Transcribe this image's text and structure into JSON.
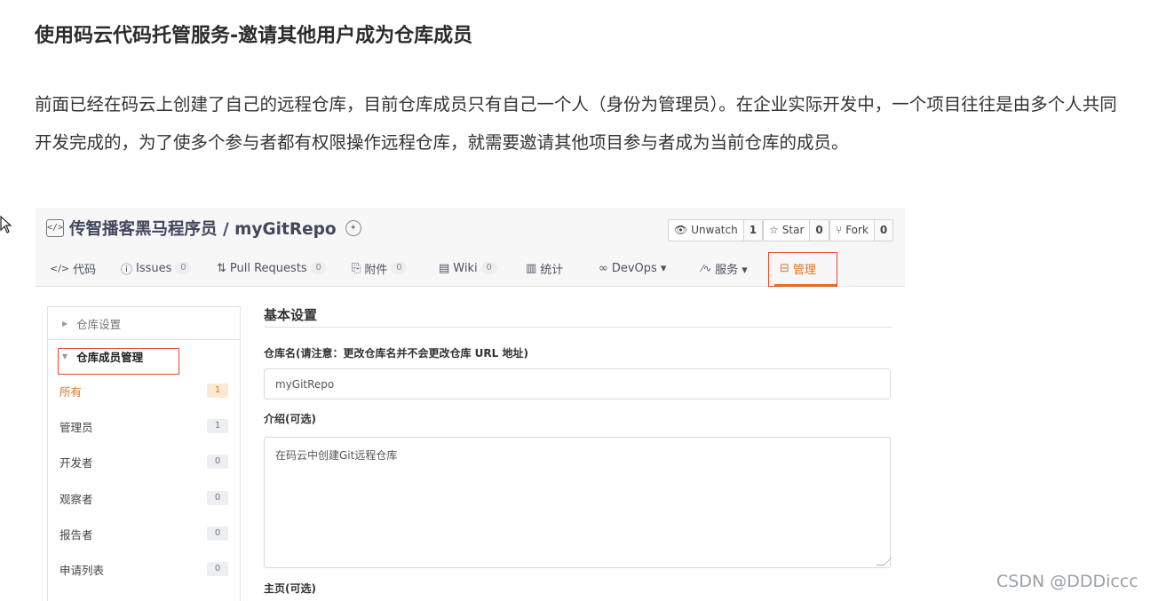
{
  "article": {
    "title": "使用码云代码托管服务-邀请其他用户成为仓库成员",
    "paragraph": "前面已经在码云上创建了自己的远程仓库，目前仓库成员只有自己一个人（身份为管理员）。在企业实际开发中，一个项目往往是由多个人共同开发完成的，为了使多个参与者都有权限操作远程仓库，就需要邀请其他项目参与者成为当前仓库的成员。"
  },
  "repo": {
    "code_icon": "</>",
    "name": "传智播客黑马程序员 / myGitRepo",
    "badge_icon": "award-badge-icon",
    "actions": [
      {
        "icon": "eye-icon",
        "glyph": "👁",
        "label": "Unwatch",
        "count": "1"
      },
      {
        "icon": "star-icon",
        "glyph": "☆",
        "label": "Star",
        "count": "0"
      },
      {
        "icon": "fork-icon",
        "glyph": "⑂",
        "label": "Fork",
        "count": "0"
      }
    ]
  },
  "tabs": [
    {
      "icon": "code-icon",
      "glyph": "</>",
      "label": "代码",
      "count": ""
    },
    {
      "icon": "issues-icon",
      "glyph": "ⓘ",
      "label": "Issues",
      "count": "0"
    },
    {
      "icon": "pull-request-icon",
      "glyph": "⇅",
      "label": "Pull Requests",
      "count": "0"
    },
    {
      "icon": "attachment-icon",
      "glyph": "⎘",
      "label": "附件",
      "count": "0"
    },
    {
      "icon": "wiki-icon",
      "glyph": "▤",
      "label": "Wiki",
      "count": "0"
    },
    {
      "icon": "stats-icon",
      "glyph": "▥",
      "label": "统计",
      "count": ""
    },
    {
      "icon": "devops-icon",
      "glyph": "∞",
      "label": "DevOps ▾",
      "count": ""
    },
    {
      "icon": "services-icon",
      "glyph": "⁄∿",
      "label": "服务 ▾",
      "count": ""
    },
    {
      "icon": "manage-icon",
      "glyph": "⊟",
      "label": "管理",
      "count": ""
    }
  ],
  "sidebar": {
    "sections": [
      {
        "label": "仓库设置"
      },
      {
        "label": "仓库成员管理"
      }
    ],
    "items": [
      {
        "label": "所有",
        "count": "1",
        "active": true
      },
      {
        "label": "管理员",
        "count": "1",
        "active": false
      },
      {
        "label": "开发者",
        "count": "0",
        "active": false
      },
      {
        "label": "观察者",
        "count": "0",
        "active": false
      },
      {
        "label": "报告者",
        "count": "0",
        "active": false
      },
      {
        "label": "申请列表",
        "count": "0",
        "active": false
      }
    ]
  },
  "settings": {
    "title": "基本设置",
    "repo_name_label": "仓库名(请注意：更改仓库名并不会更改仓库 URL 地址)",
    "repo_name_value": "myGitRepo",
    "intro_label": "介绍(可选)",
    "intro_value": "在码云中创建Git远程仓库",
    "homepage_label": "主页(可选)"
  },
  "watermark": "CSDN @DDDiccc",
  "colors": {
    "accent": "#e5721a",
    "highlight_box": "#e04a2b"
  }
}
